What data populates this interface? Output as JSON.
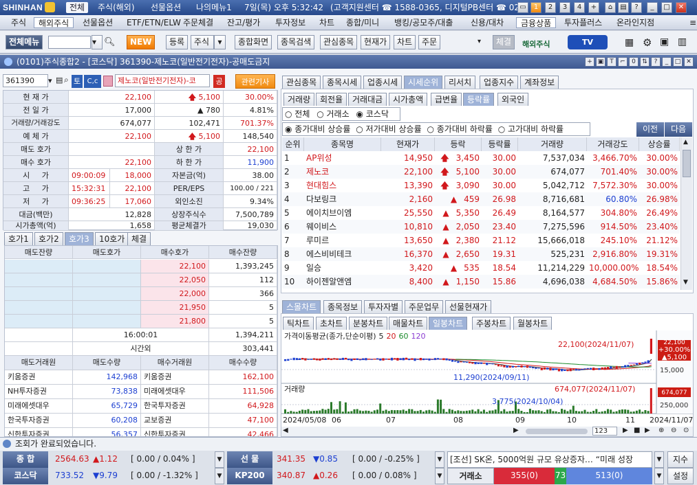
{
  "titlebar": {
    "brand": "SHINHAN",
    "nav": [
      "전체",
      "주식(해외)",
      "선물옵션",
      "나의메뉴1"
    ],
    "datetime": "7일(목) 오후 5:32:42",
    "support": "(고객지원센터 ☎ 1588-0365, 디지털PB센터 ☎ 02",
    "screen_numbers": [
      "1",
      "2",
      "3",
      "4"
    ]
  },
  "menubar": [
    "주식",
    "해외주식",
    "선물옵션",
    "ETF/ETN/ELW",
    "주문체결",
    "잔고/평가",
    "투자정보",
    "차트",
    "종합/미니",
    "뱅킹/공모주/대출",
    "신용/대차",
    "금융상품",
    "투자플러스",
    "온라인지점"
  ],
  "toolbar": {
    "all_menu": "전체메뉴",
    "new": "NEW",
    "register": "등록",
    "stock_select": "주식",
    "buttons": [
      "종합화면",
      "종목검색",
      "관심종목",
      "현재가",
      "차트",
      "주문"
    ],
    "fill": "체결",
    "overseas": "해외주식",
    "tv": "TV"
  },
  "window": {
    "title": "(0101)주식종합2 - [코스닥] 361390-제노코(일반전기전자)-공매도금지"
  },
  "stock": {
    "code": "361390",
    "btn_to": "토",
    "btn_cc": "C,c",
    "name": "제노코(일반전기전자)-코",
    "gong": "공",
    "news": "관련기사",
    "rows": [
      {
        "label": "현 재 가",
        "a": "22,100",
        "b": "5,100",
        "c": "30.00%"
      },
      {
        "label": "전 일 가",
        "a": "17,000",
        "b": "780",
        "c": "4.81%"
      },
      {
        "label": "거래량/거래강도",
        "a": "674,077",
        "b": "102,471",
        "c": "701.37%"
      },
      {
        "label": "예 체 가",
        "a": "22,100",
        "b": "5,100",
        "c": "148,540"
      }
    ],
    "quote_rows": [
      {
        "label": "매도 호가",
        "v": "",
        "k": "상 한 가",
        "kv": "22,100"
      },
      {
        "label": "매수 호가",
        "v": "22,100",
        "k": "하 한 가",
        "kv": "11,900"
      }
    ],
    "price_rows": [
      {
        "label": "시     가",
        "t": "09:00:09",
        "v": "18,000",
        "k": "자본금(억)",
        "kv": "38.00"
      },
      {
        "label": "고     가",
        "t": "15:32:31",
        "v": "22,100",
        "k": "PER/EPS",
        "kv": "100.00 / 221"
      },
      {
        "label": "저     가",
        "t": "09:36:25",
        "v": "17,060",
        "k": "외인소진",
        "kv": "9.34%"
      }
    ],
    "misc_rows": [
      {
        "label": "대금(백만)",
        "v": "12,828",
        "k": "상장주식수",
        "kv": "7,500,789"
      },
      {
        "label": "시가총액(억)",
        "v": "1,658",
        "k": "평균체결가",
        "kv": "19,030"
      }
    ]
  },
  "hoga": {
    "tabs": [
      "호가1",
      "호가2",
      "호가3",
      "10호가",
      "체결"
    ],
    "headers": [
      "매도잔량",
      "매도호가",
      "매수호가",
      "매수잔량"
    ],
    "bids": [
      {
        "price": "22,100",
        "qty": "1,393,245"
      },
      {
        "price": "22,050",
        "qty": "112"
      },
      {
        "price": "22,000",
        "qty": "366"
      },
      {
        "price": "21,950",
        "qty": "5"
      },
      {
        "price": "21,800",
        "qty": "5"
      }
    ],
    "time": "16:00:01",
    "time_qty": "1,394,211",
    "after_label": "시간외",
    "after_qty": "303,441",
    "broker_headers": [
      "매도거래원",
      "매도수량",
      "매수거래원",
      "매수수량"
    ],
    "brokers": [
      {
        "s": "키움증권",
        "sq": "142,968",
        "b": "키움증권",
        "bq": "162,100"
      },
      {
        "s": "NH투자증권",
        "sq": "73,838",
        "b": "미래에셋대우",
        "bq": "111,506"
      },
      {
        "s": "미래에셋대우",
        "sq": "65,729",
        "b": "한국투자증권",
        "bq": "64,928"
      },
      {
        "s": "한국투자증권",
        "sq": "60,208",
        "b": "교보증권",
        "bq": "47,100"
      },
      {
        "s": "신한투자증권",
        "sq": "56,357",
        "b": "신한투자증권",
        "bq": "42,466"
      }
    ]
  },
  "rank": {
    "tabs": [
      "관심종목",
      "종목시세",
      "업종시세",
      "시세순위",
      "리서치",
      "업종지수",
      "계좌정보"
    ],
    "subtabs": [
      "거래량",
      "회전율",
      "거래대금",
      "시가총액",
      "급변율",
      "등락률",
      "외국인"
    ],
    "market_opts": [
      "전체",
      "거래소",
      "코스닥"
    ],
    "sort_opts": [
      "종가대비 상승률",
      "저가대비 상승률",
      "종가대비 하락률",
      "고가대비 하락률"
    ],
    "prev": "이전",
    "next": "다음",
    "headers": [
      "순위",
      "종목명",
      "현재가",
      "등락",
      "등락률",
      "거래량",
      "거래강도",
      "상승률"
    ],
    "rows": [
      {
        "rank": "1",
        "name": "AP위성",
        "price": "14,950",
        "chg": "3,450",
        "pct": "30.00",
        "vol": "7,537,034",
        "str": "3,466.70%",
        "up": "30.00%",
        "lim": true
      },
      {
        "rank": "2",
        "name": "제노코",
        "price": "22,100",
        "chg": "5,100",
        "pct": "30.00",
        "vol": "674,077",
        "str": "701.40%",
        "up": "30.00%",
        "lim": true
      },
      {
        "rank": "3",
        "name": "현대힘스",
        "price": "13,390",
        "chg": "3,090",
        "pct": "30.00",
        "vol": "5,042,712",
        "str": "7,572.30%",
        "up": "30.00%",
        "lim": true
      },
      {
        "rank": "4",
        "name": "다보링크",
        "price": "2,160",
        "chg": "459",
        "pct": "26.98",
        "vol": "8,716,681",
        "str": "60.80%",
        "up": "26.98%",
        "lim": false,
        "weak": true
      },
      {
        "rank": "5",
        "name": "에이치브이엠",
        "price": "25,550",
        "chg": "5,350",
        "pct": "26.49",
        "vol": "8,164,577",
        "str": "304.80%",
        "up": "26.49%",
        "lim": false
      },
      {
        "rank": "6",
        "name": "웨이비스",
        "price": "10,810",
        "chg": "2,050",
        "pct": "23.40",
        "vol": "7,275,596",
        "str": "914.50%",
        "up": "23.40%",
        "lim": false
      },
      {
        "rank": "7",
        "name": "루미르",
        "price": "13,650",
        "chg": "2,380",
        "pct": "21.12",
        "vol": "15,666,018",
        "str": "245.10%",
        "up": "21.12%",
        "lim": false
      },
      {
        "rank": "8",
        "name": "에스비비테크",
        "price": "16,370",
        "chg": "2,650",
        "pct": "19.31",
        "vol": "525,231",
        "str": "2,916.80%",
        "up": "19.31%",
        "lim": false
      },
      {
        "rank": "9",
        "name": "일승",
        "price": "3,420",
        "chg": "535",
        "pct": "18.54",
        "vol": "11,214,229",
        "str": "10,000.00%",
        "up": "18.54%",
        "lim": false
      },
      {
        "rank": "10",
        "name": "하이젠알앤엠",
        "price": "8,400",
        "chg": "1,150",
        "pct": "15.86",
        "vol": "4,696,038",
        "str": "4,684.50%",
        "up": "15.86%",
        "lim": false
      }
    ]
  },
  "chart": {
    "tabs": [
      "스몰차트",
      "종목정보",
      "투자자별",
      "주문업무",
      "선물현재가"
    ],
    "period_tabs": [
      "틱차트",
      "초차트",
      "분봉차트",
      "매물차트",
      "일봉차트",
      "주봉차트",
      "월봉차트"
    ],
    "legend": "가격이동평균(종가,단순이평)",
    "ma": [
      "5",
      "20",
      "60",
      "120"
    ],
    "high_label": "22,100(2024/11/07)",
    "low_label": "11,290(2024/09/11)",
    "price_tag": [
      "22,100",
      "+30.00%",
      "▲5,100"
    ],
    "price_axis": "15,000",
    "vol_title": "거래량",
    "vol_high": "674,077(2024/11/07)",
    "vol_low": "3,775(2024/10/04)",
    "vol_axis": "250,000",
    "vol_tag": "674,077",
    "dates": [
      "2024/05/08",
      "06",
      "07",
      "08",
      "09",
      "10",
      "11",
      "2024/11/07"
    ],
    "zoom": "123"
  },
  "status": {
    "msg": "조회가 완료되었습니다."
  },
  "ticker": {
    "row1": [
      {
        "name": "종 합",
        "val": "2564.63",
        "chg": "▲1.12",
        "extra": "[ 0.00 / 0.04% ]",
        "dir": "up"
      },
      {
        "name": "선 물",
        "val": "341.35",
        "chg": "▼0.85",
        "extra": "[ 0.00 / -0.25% ]",
        "dir": "dn"
      }
    ],
    "row2": [
      {
        "name": "코스닥",
        "val": "733.52",
        "chg": "▼9.79",
        "extra": "[ 0.00 / -1.32% ]",
        "dir": "dn"
      },
      {
        "name": "KP200",
        "val": "340.87",
        "chg": "▲0.26",
        "extra": "[ 0.00 / 0.08% ]",
        "dir": "up"
      }
    ],
    "news": "[조선] SK온, 5000억원 규모 유상증자… “미래 성장",
    "jisu": "지수",
    "exchange": "거래소",
    "adv": "355(0)",
    "flat": "73",
    "dec": "513(0)",
    "settings": "설정"
  }
}
